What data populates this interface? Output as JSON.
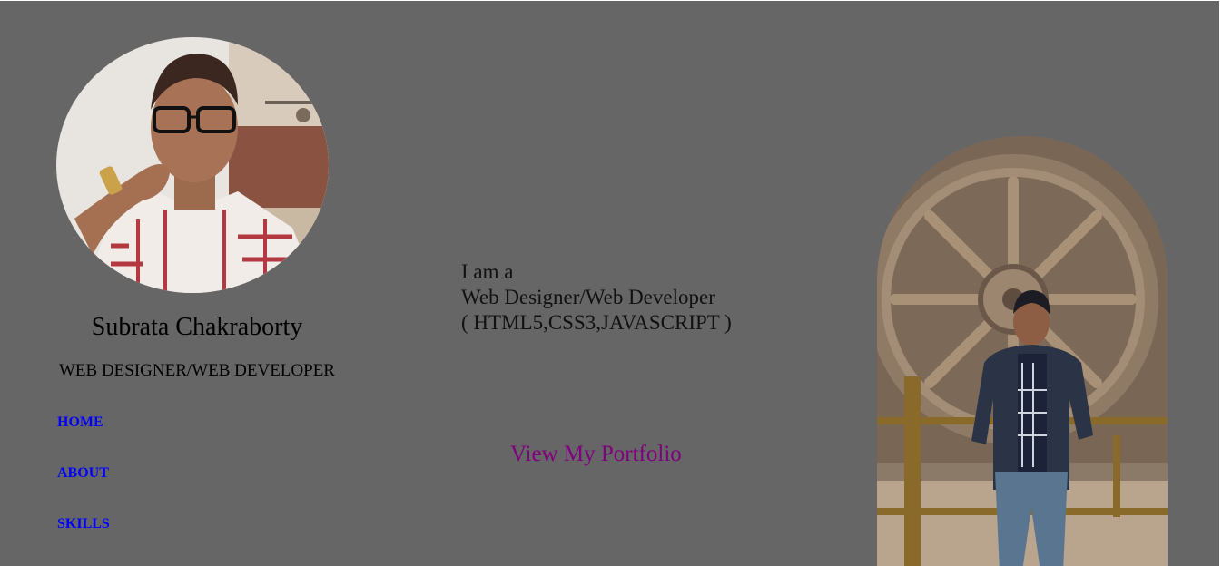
{
  "profile": {
    "name": "Subrata Chakraborty",
    "role": "WEB DESIGNER/WEB DEVELOPER"
  },
  "nav": {
    "items": [
      {
        "label": "HOME"
      },
      {
        "label": "ABOUT"
      },
      {
        "label": "SKILLS"
      }
    ]
  },
  "intro": {
    "line1": "I am a",
    "line2": "Web Designer/Web Developer",
    "line3": "( HTML5,CSS3,JAVASCRIPT )"
  },
  "portfolio": {
    "link_label": "View My Portfolio"
  },
  "colors": {
    "page_bg": "#666666",
    "nav_link": "#0000ff",
    "visited_link": "#800080"
  }
}
